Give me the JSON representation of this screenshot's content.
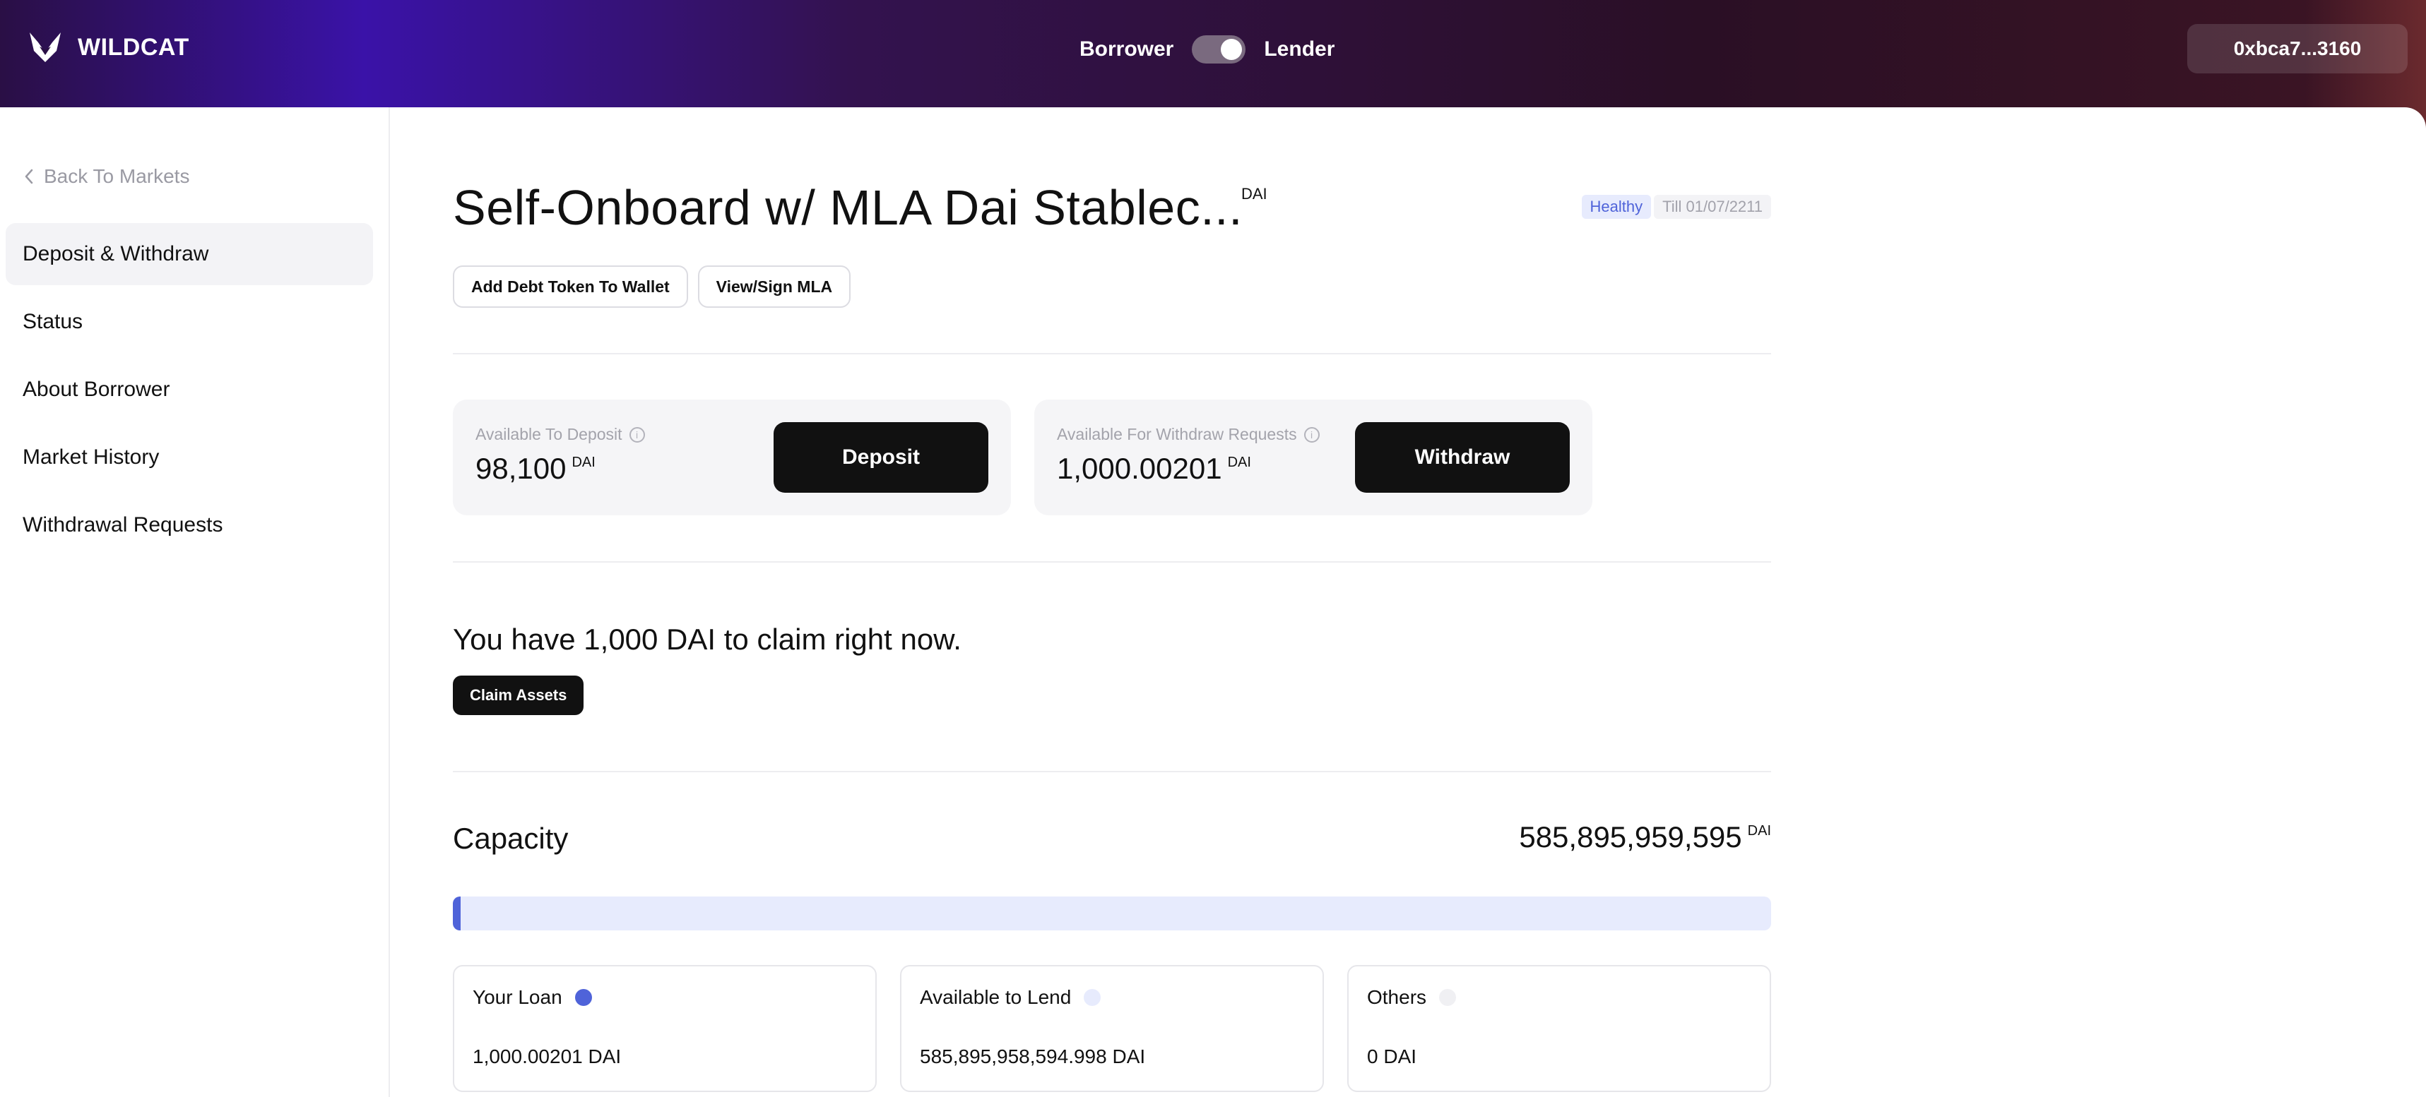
{
  "header": {
    "logo_text": "WILDCAT",
    "role_left": "Borrower",
    "role_right": "Lender",
    "role_active": "Lender",
    "wallet": "0xbca7...3160"
  },
  "sidebar": {
    "back_label": "Back To Markets",
    "items": [
      {
        "label": "Deposit & Withdraw",
        "active": true
      },
      {
        "label": "Status"
      },
      {
        "label": "About Borrower"
      },
      {
        "label": "Market History"
      },
      {
        "label": "Withdrawal Requests"
      }
    ]
  },
  "market": {
    "title": "Self-Onboard w/ MLA Dai Stablec...",
    "asset": "DAI",
    "status": "Healthy",
    "term": "Till 01/07/2211",
    "actions": {
      "add_token": "Add Debt Token To Wallet",
      "view_mla": "View/Sign MLA"
    }
  },
  "deposit": {
    "label": "Available To Deposit",
    "value": "98,100",
    "unit": "DAI",
    "button": "Deposit"
  },
  "withdraw": {
    "label": "Available For Withdraw Requests",
    "value": "1,000.00201",
    "unit": "DAI",
    "button": "Withdraw"
  },
  "claim": {
    "text": "You have 1,000 DAI to claim right now.",
    "button": "Claim Assets"
  },
  "capacity": {
    "title": "Capacity",
    "value": "585,895,959,595",
    "unit": "DAI",
    "loan_fraction": 0.006,
    "colors": {
      "loan": "#4f63d9",
      "available": "#e7ebfd",
      "others": "#f0f0f3"
    },
    "cards": [
      {
        "label": "Your Loan",
        "value": "1,000.00201 DAI"
      },
      {
        "label": "Available to Lend",
        "value": "585,895,958,594.998 DAI"
      },
      {
        "label": "Others",
        "value": "0 DAI"
      }
    ]
  }
}
